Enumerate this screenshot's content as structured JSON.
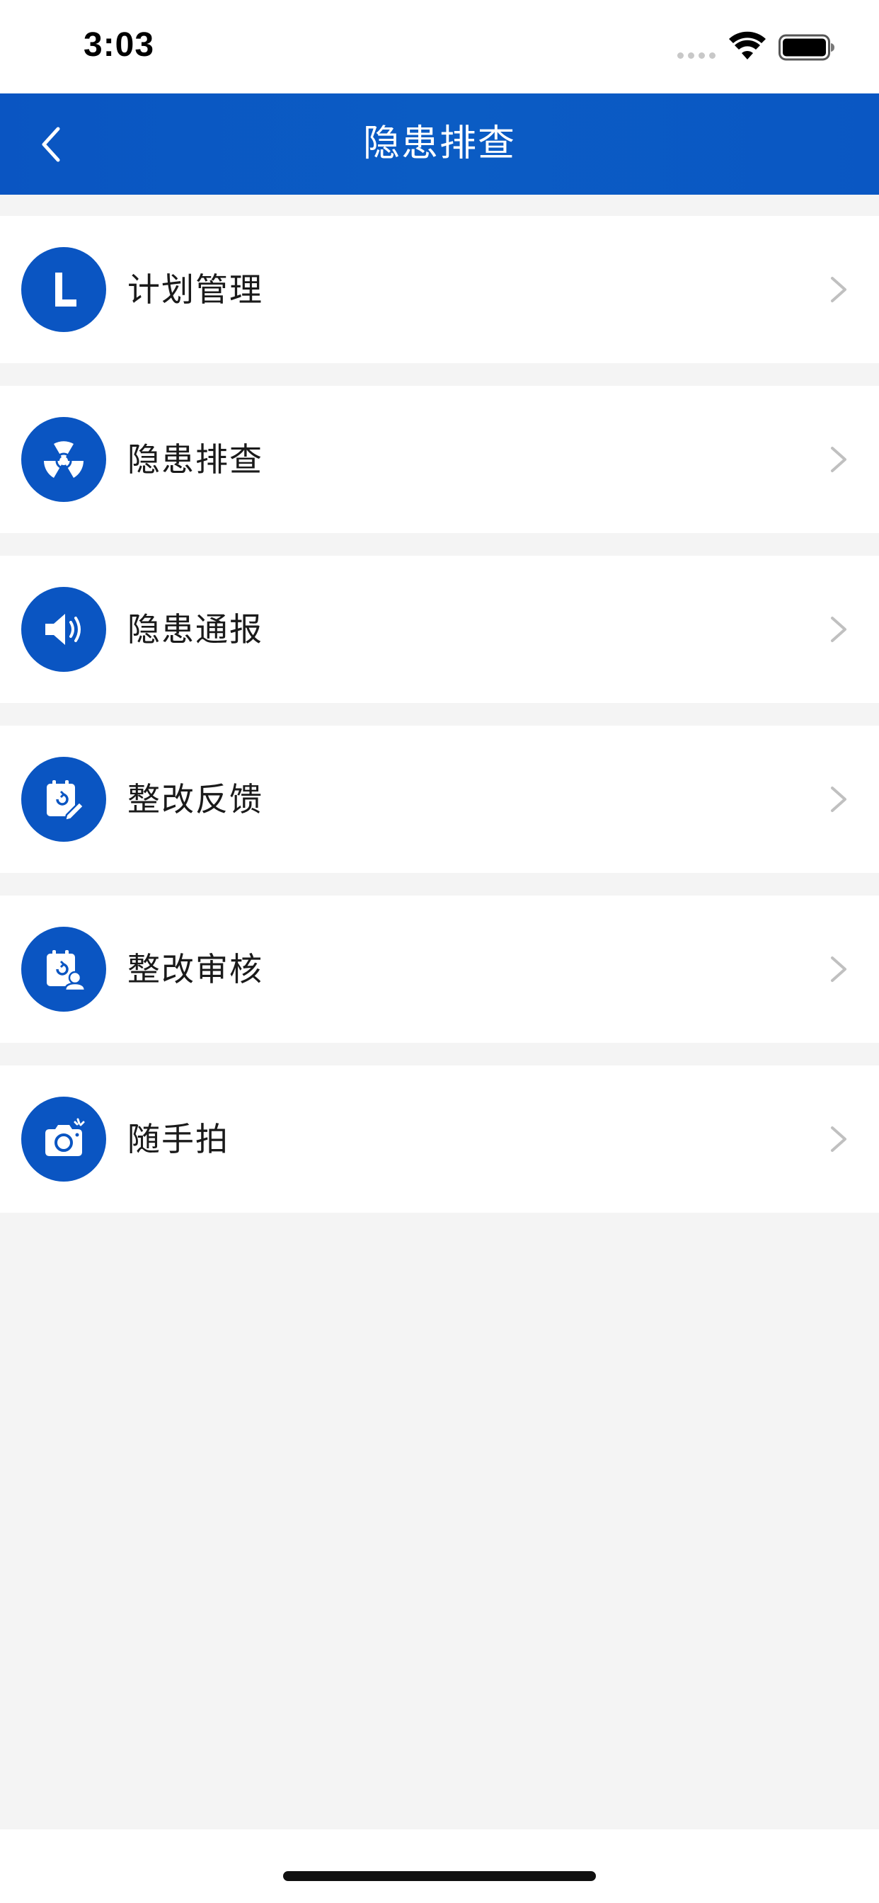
{
  "status_bar": {
    "time": "3:03"
  },
  "nav": {
    "title": "隐患排查"
  },
  "menu": [
    {
      "label": "计划管理",
      "icon": "clock-plan-icon"
    },
    {
      "label": "隐患排查",
      "icon": "radiation-icon"
    },
    {
      "label": "隐患通报",
      "icon": "speaker-icon"
    },
    {
      "label": "整改反馈",
      "icon": "clipboard-edit-icon"
    },
    {
      "label": "整改审核",
      "icon": "clipboard-user-icon"
    },
    {
      "label": "随手拍",
      "icon": "camera-icon"
    }
  ],
  "colors": {
    "brand": "#0a55c2",
    "background": "#f4f4f4",
    "chevron": "#c0c0c0"
  }
}
